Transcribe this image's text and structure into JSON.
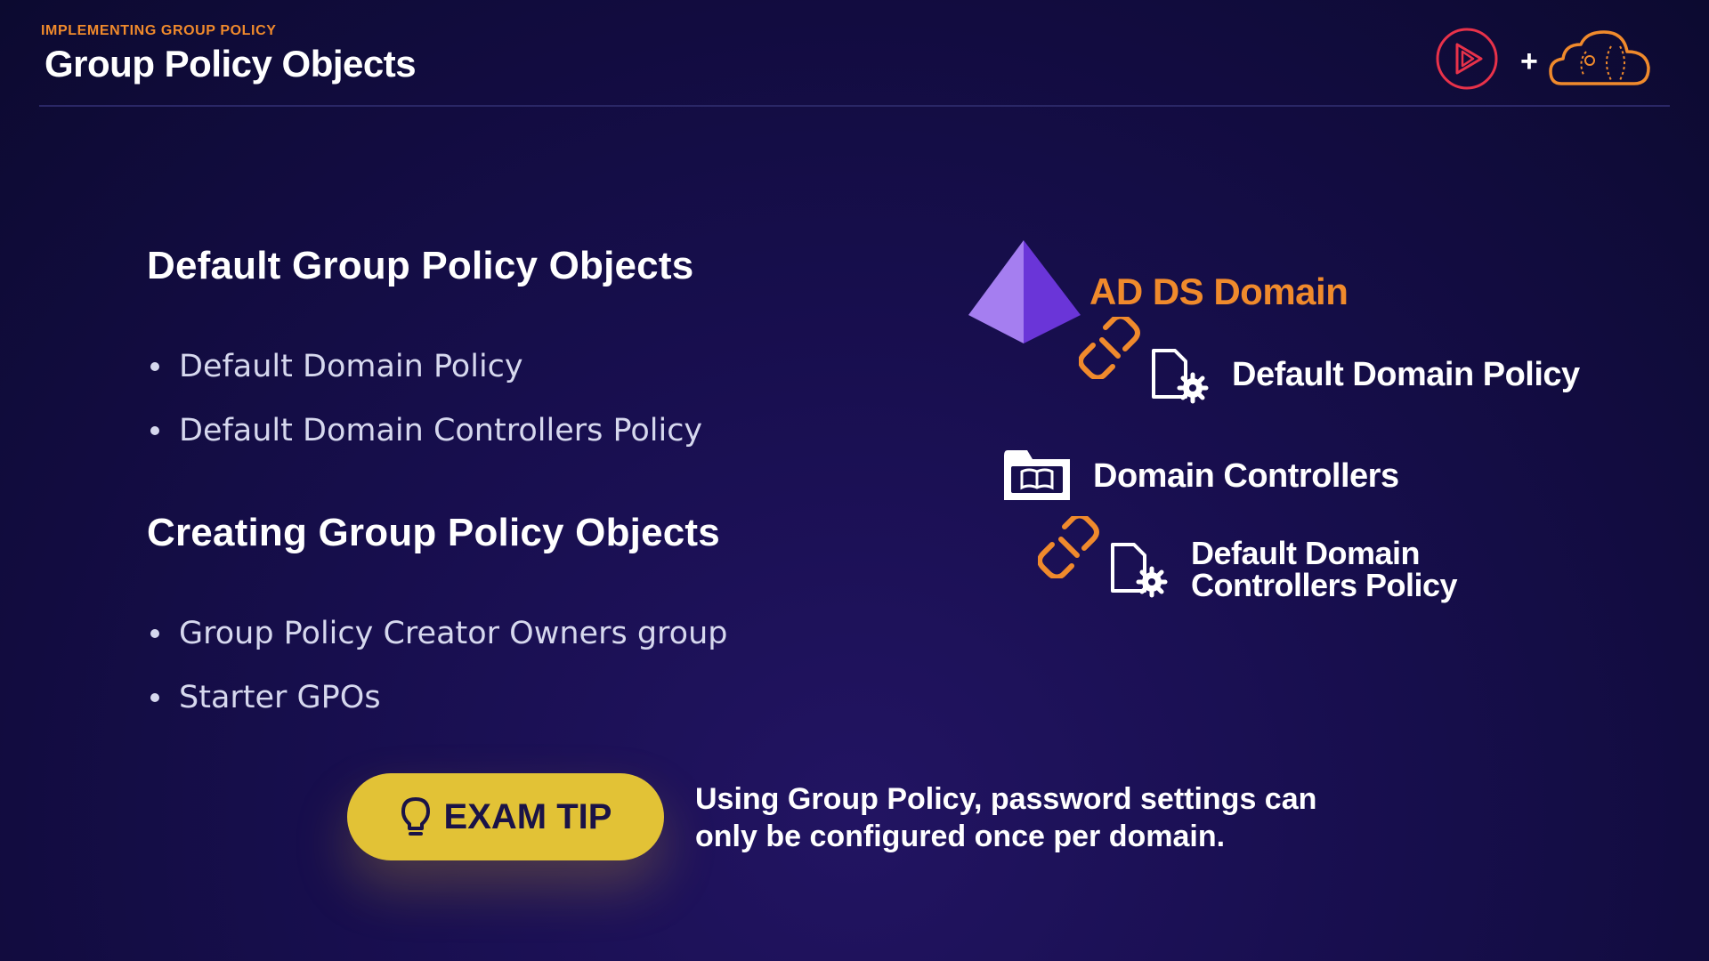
{
  "header": {
    "eyebrow": "IMPLEMENTING GROUP POLICY",
    "title": "Group Policy Objects",
    "plus": "+"
  },
  "sections": [
    {
      "heading": "Default Group Policy Objects",
      "bullets": [
        "Default Domain Policy",
        "Default Domain Controllers Policy"
      ]
    },
    {
      "heading": "Creating Group Policy Objects",
      "bullets": [
        "Group Policy Creator Owners group",
        "Starter GPOs"
      ]
    }
  ],
  "diagram": {
    "domain_label": "AD DS Domain",
    "domain_policy": "Default Domain Policy",
    "ou_label": "Domain Controllers",
    "dc_policy_line1": "Default Domain",
    "dc_policy_line2": "Controllers Policy",
    "icons": [
      "pyramid-icon",
      "link-icon",
      "document-gear-icon",
      "folder-book-icon"
    ]
  },
  "exam_tip": {
    "label": "EXAM TIP",
    "icon": "lightbulb-icon",
    "text_line1": "Using Group Policy, password settings can",
    "text_line2": "only be configured once per domain."
  },
  "colors": {
    "accent_orange": "#f08a2c",
    "tip_yellow": "#e2c236",
    "background": "#170e4d",
    "pyramid_light": "#a57ef0",
    "pyramid_dark": "#6a35d8",
    "brand_red": "#e8324a"
  }
}
